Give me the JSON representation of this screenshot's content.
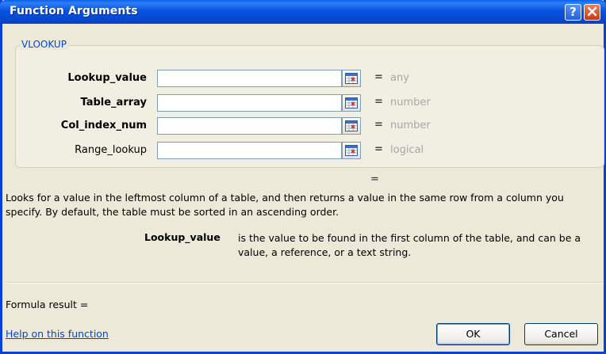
{
  "window": {
    "title": "Function Arguments",
    "help_glyph": "?",
    "close_icon": "close-icon"
  },
  "function_group": {
    "name": "VLOOKUP",
    "arguments": [
      {
        "label": "Lookup_value",
        "value": "",
        "type": "any",
        "required": true
      },
      {
        "label": "Table_array",
        "value": "",
        "type": "number",
        "required": true
      },
      {
        "label": "Col_index_num",
        "value": "",
        "type": "number",
        "required": true
      },
      {
        "label": "Range_lookup",
        "value": "",
        "type": "logical",
        "required": false
      }
    ],
    "equals_sign": "="
  },
  "result_equals": "=",
  "description": "Looks for a value in the leftmost column of a table, and then returns a value in the same row from a column you specify. By default, the table must be sorted in an ascending order.",
  "argument_help": {
    "name": "Lookup_value",
    "text": "is the value to be found in the first column of the table, and can be a value, a reference, or a text string."
  },
  "formula_result_label": "Formula result =",
  "help_link": "Help on this function",
  "buttons": {
    "ok": "OK",
    "cancel": "Cancel"
  },
  "colors": {
    "titlebar": "#0a53e0",
    "group_label": "#0046d5",
    "type_text": "#a7a7a7",
    "link": "#0046d5"
  }
}
